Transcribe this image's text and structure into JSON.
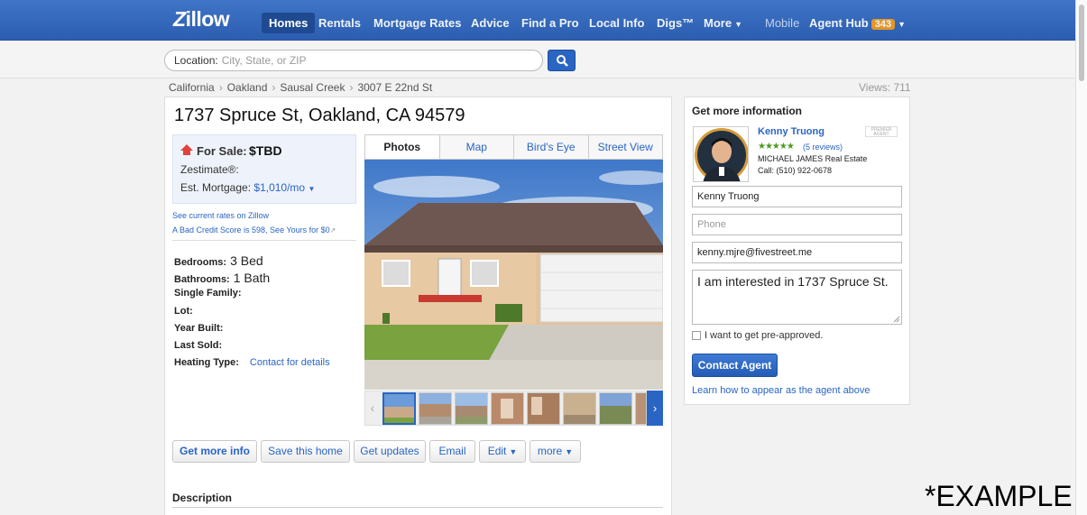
{
  "nav": {
    "logo": "Zillow",
    "items": [
      "Homes",
      "Rentals",
      "Mortgage Rates",
      "Advice",
      "Find a Pro",
      "Local Info",
      "Digs™",
      "More"
    ],
    "mobile": "Mobile",
    "agent_hub": "Agent Hub",
    "agent_hub_count": "343"
  },
  "search": {
    "label": "Location:",
    "placeholder": "City, State, or ZIP",
    "icon": "magnifier-icon"
  },
  "breadcrumb": [
    "California",
    "Oakland",
    "Sausal Creek",
    "3007 E 22nd St"
  ],
  "views": "Views: 711",
  "listing": {
    "address": "1737 Spruce St, Oakland, CA 94579",
    "for_sale_label": "For Sale:",
    "price": "$TBD",
    "zestimate_label": "Zestimate®:",
    "est_mortgage_label": "Est. Mortgage:",
    "est_mortgage_value": "$1,010/mo",
    "rates_link": "See current rates on Zillow",
    "credit_link": "A Bad Credit Score is 598, See Yours for $0",
    "facts": {
      "bedrooms_label": "Bedrooms:",
      "bedrooms_value": "3 Bed",
      "bathrooms_label": "Bathrooms:",
      "bathrooms_value": "1 Bath",
      "type_label": "Single Family:",
      "lot_label": "Lot:",
      "year_label": "Year Built:",
      "sold_label": "Last Sold:",
      "heating_label": "Heating Type:",
      "heating_link": "Contact for details"
    }
  },
  "photo_tabs": [
    "Photos",
    "Map",
    "Bird's Eye",
    "Street View"
  ],
  "actions": [
    "Get more info",
    "Save this home",
    "Get updates",
    "Email",
    "Edit",
    "more"
  ],
  "description_heading": "Description",
  "agent_panel": {
    "heading": "Get more information",
    "agent_name": "Kenny Truong",
    "premier": "PREMIER AGENT",
    "stars": "★★★★★",
    "reviews": "(5 reviews)",
    "company": "MICHAEL JAMES Real Estate",
    "phone": "Call: (510) 922-0678",
    "name_value": "Kenny Truong",
    "phone_placeholder": "Phone",
    "email_value": "kenny.mjre@fivestreet.me",
    "message_value": "I am interested in 1737 Spruce St.",
    "preapproved_label": "I want to get pre-approved.",
    "contact_button": "Contact Agent",
    "learn_link": "Learn how to appear as the agent above"
  },
  "watermark": "*EXAMPLE",
  "colors": {
    "nav_blue": "#3f74c6",
    "link_blue": "#2a65c4",
    "badge_orange": "#f39a1a",
    "star_green": "#4c9a1f"
  }
}
